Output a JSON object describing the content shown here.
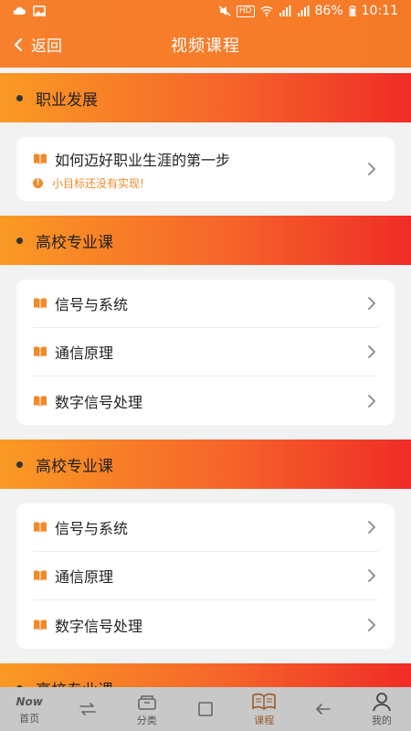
{
  "status_bar": {
    "battery": "86%",
    "time": "10:11",
    "network_badge": "HD"
  },
  "header": {
    "back_label": "返回",
    "title": "视频课程"
  },
  "sections": [
    {
      "title": "职业发展",
      "items": [
        {
          "label": "如何迈好职业生涯的第一步",
          "sub": "小目标还没有实现!"
        }
      ]
    },
    {
      "title": "高校专业课",
      "items": [
        {
          "label": "信号与系统"
        },
        {
          "label": "通信原理"
        },
        {
          "label": "数字信号处理"
        }
      ]
    },
    {
      "title": "高校专业课",
      "items": [
        {
          "label": "信号与系统"
        },
        {
          "label": "通信原理"
        },
        {
          "label": "数字信号处理"
        }
      ]
    },
    {
      "title": "高校专业课",
      "items": []
    }
  ],
  "bottom_nav": [
    {
      "label": "首页",
      "badge": "Now"
    },
    {
      "label": ""
    },
    {
      "label": "分类"
    },
    {
      "label": ""
    },
    {
      "label": "课程"
    },
    {
      "label": ""
    },
    {
      "label": "我的"
    }
  ],
  "colors": {
    "header": "#f7802c",
    "banner_start": "#fa9a24",
    "banner_end": "#ef2c26",
    "accent": "#f08a2a"
  }
}
